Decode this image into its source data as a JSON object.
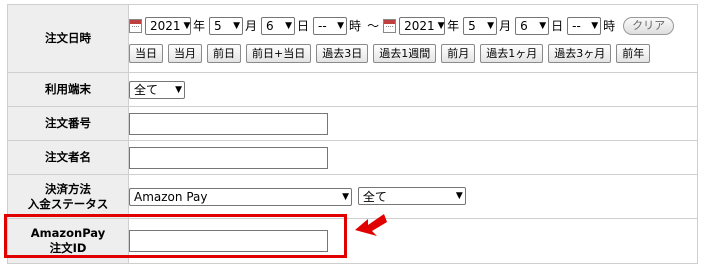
{
  "order_date": {
    "label": "注文日時",
    "from": {
      "year": "2021",
      "month": "5",
      "day": "6",
      "hour": "--"
    },
    "to": {
      "year": "2021",
      "month": "5",
      "day": "6",
      "hour": "--"
    },
    "unit_year": "年",
    "unit_month": "月",
    "unit_day": "日",
    "unit_hour": "時",
    "separator": "～",
    "clear_label": "クリア",
    "quick_buttons": [
      "当日",
      "当月",
      "前日",
      "前日+当日",
      "過去3日",
      "過去1週間",
      "前月",
      "過去1ヶ月",
      "過去3ヶ月",
      "前年"
    ]
  },
  "device": {
    "label": "利用端末",
    "value": "全て"
  },
  "order_number": {
    "label": "注文番号",
    "value": ""
  },
  "orderer_name": {
    "label": "注文者名",
    "value": ""
  },
  "payment": {
    "label_line1": "決済方法",
    "label_line2": "入金ステータス",
    "method_value": "Amazon Pay",
    "status_value": "全て"
  },
  "amazonpay_id": {
    "label_line1": "AmazonPay",
    "label_line2": "注文ID",
    "value": ""
  },
  "colors": {
    "highlight": "#e00000",
    "label_bg": "#eeeeee",
    "border": "#cfcfcf"
  }
}
